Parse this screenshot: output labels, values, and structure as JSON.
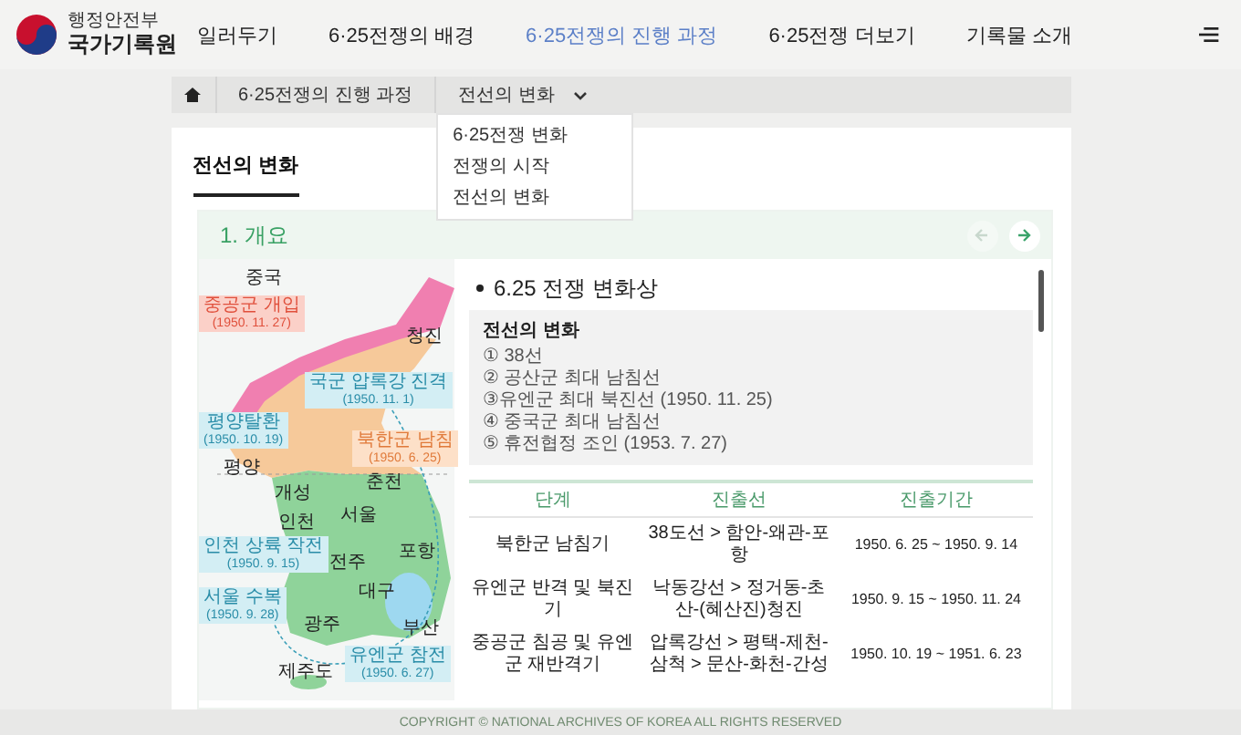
{
  "header": {
    "ministry": "행정안전부",
    "agency": "국가기록원",
    "nav": [
      {
        "label": "일러두기",
        "selected": false
      },
      {
        "label": "6·25전쟁의 배경",
        "selected": false
      },
      {
        "label": "6·25전쟁의 진행 과정",
        "selected": true
      },
      {
        "label": "6·25전쟁 더보기",
        "selected": false
      },
      {
        "label": "기록물 소개",
        "selected": false
      }
    ]
  },
  "breadcrumb": {
    "items": [
      "6·25전쟁의 진행 과정",
      "전선의 변화"
    ],
    "dropdown": {
      "expanded": true,
      "options": [
        "6·25전쟁 변화",
        "전쟁의 시작",
        "전선의 변화"
      ]
    }
  },
  "page_title": "전선의 변화",
  "section": {
    "title": "1. 개요",
    "prev": {
      "disabled": true
    },
    "next": {
      "disabled": false
    }
  },
  "map": {
    "labels": [
      {
        "kind": "place",
        "text": "중국"
      },
      {
        "kind": "callout-red",
        "text": "중공군 개입",
        "date": "(1950. 11. 27)"
      },
      {
        "kind": "place",
        "text": "청진"
      },
      {
        "kind": "callout-blue",
        "text": "국군 압록강 진격",
        "date": "(1950. 11. 1)"
      },
      {
        "kind": "callout-blue",
        "text": "평양탈환",
        "date": "(1950. 10. 19)"
      },
      {
        "kind": "place",
        "text": "평양"
      },
      {
        "kind": "callout-orange",
        "text": "북한군 남침",
        "date": "(1950. 6. 25)"
      },
      {
        "kind": "place",
        "text": "개성"
      },
      {
        "kind": "place",
        "text": "춘천"
      },
      {
        "kind": "place",
        "text": "인천"
      },
      {
        "kind": "place",
        "text": "서울"
      },
      {
        "kind": "callout-blue",
        "text": "인천 상륙 작전",
        "date": "(1950. 9. 15)"
      },
      {
        "kind": "callout-blue",
        "text": "서울 수복",
        "date": "(1950. 9. 28)"
      },
      {
        "kind": "place",
        "text": "전주"
      },
      {
        "kind": "place",
        "text": "광주"
      },
      {
        "kind": "place",
        "text": "포항"
      },
      {
        "kind": "place",
        "text": "대구"
      },
      {
        "kind": "place",
        "text": "부산"
      },
      {
        "kind": "place",
        "text": "제주도"
      },
      {
        "kind": "callout-blue",
        "text": "유엔군 참전",
        "date": "(1950. 6. 27)"
      }
    ]
  },
  "summary": {
    "heading": "6.25 전쟁 변화상",
    "box_title": "전선의 변화",
    "items": [
      "① 38선",
      "② 공산군 최대 남침선",
      "③유엔군 최대 북진선 (1950. 11. 25)",
      "④ 중국군 최대 남침선",
      "⑤ 휴전협정 조인 (1953. 7. 27)"
    ]
  },
  "table": {
    "columns": [
      "단계",
      "진출선",
      "진출기간"
    ],
    "rows": [
      [
        "북한군 남침기",
        "38도선 > 함안-왜관-포항",
        "1950. 6. 25 ~ 1950. 9. 14"
      ],
      [
        "유엔군 반격 및 북진기",
        "낙동강선 > 정거동-초산-(혜산진)청진",
        "1950. 9. 15 ~ 1950. 11. 24"
      ],
      [
        "중공군 침공 및 유엔군 재반격기",
        "압록강선 > 평택-제천-삼척 > 문산-화천-간성",
        "1950. 10. 19 ~ 1951. 6. 23"
      ]
    ]
  },
  "footer": "COPYRIGHT © NATIONAL ARCHIVES OF KOREA ALL RIGHTS RESERVED"
}
